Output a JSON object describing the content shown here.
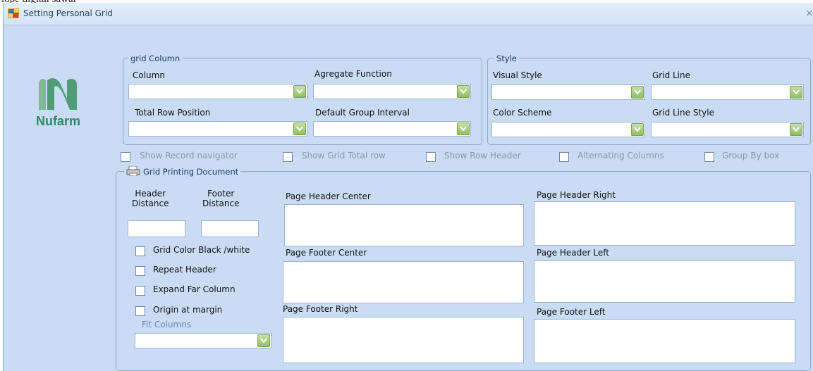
{
  "caption_crop": "lope digital sawal",
  "window": {
    "title": "Setting Personal Grid",
    "close_glyph": "×"
  },
  "logo": {
    "text": "Nufarm",
    "color": "#2f8a5f"
  },
  "grid_column_group": {
    "legend": "grid Column",
    "column_label": "Column",
    "aggregate_label": "Agregate Function",
    "total_row_label": "Total Row Position",
    "default_group_label": "Default Group Interval"
  },
  "style_group": {
    "legend": "Style",
    "visual_style_label": "Visual Style",
    "grid_line_label": "Grid Line",
    "color_scheme_label": "Color Scheme",
    "grid_line_style_label": "Grid Line Style"
  },
  "options": [
    {
      "label": "Show Record navigator",
      "checked": false
    },
    {
      "label": "Show Grid Total row",
      "checked": false
    },
    {
      "label": "Show Row Header",
      "checked": false
    },
    {
      "label": "Alternating Columns",
      "checked": false
    },
    {
      "label": "Group By box",
      "checked": false
    }
  ],
  "printing_group": {
    "legend": "Grid Printing Document",
    "header_distance_label": "Header\nDistance",
    "footer_distance_label": "Footer\nDistance",
    "header_distance_value": "",
    "footer_distance_value": "",
    "grid_color_label": "Grid Color Black /white",
    "repeat_header_label": "Repeat Header",
    "expand_far_label": "Expand Far Column",
    "origin_margin_label": "Origin at margin",
    "fit_columns_label": "Fit Columns",
    "page_header_center": "Page Header Center",
    "page_header_right": "Page Header Right",
    "page_footer_center": "Page Footer Center",
    "page_header_left": "Page Header Left",
    "page_footer_right": "Page Footer Right",
    "page_footer_left": "Page Footer Left"
  },
  "colors": {
    "window_bg": "#c9dcf3",
    "dropdown_button": "#9cc873",
    "disabled_text": "#8b98aa"
  }
}
